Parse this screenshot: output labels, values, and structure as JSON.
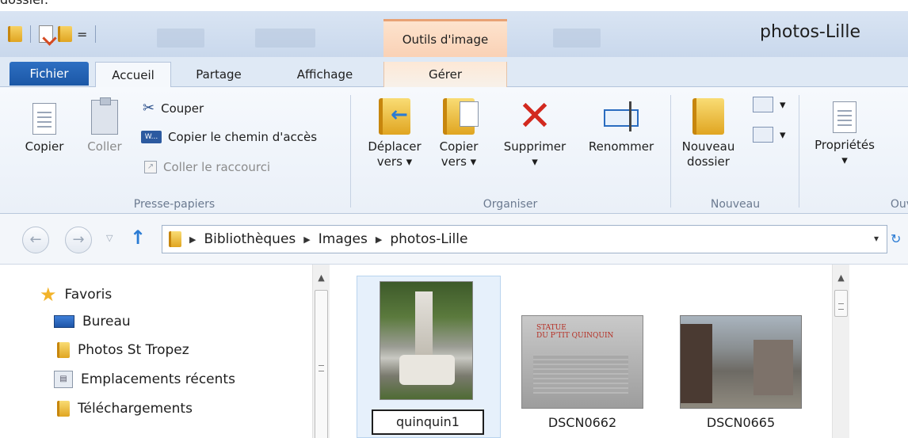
{
  "cropped_top_text": "dossier.",
  "window": {
    "title": "photos-Lille",
    "contextual_group": "Outils d'image"
  },
  "tabs": {
    "file": "Fichier",
    "home": "Accueil",
    "share": "Partage",
    "view": "Affichage",
    "manage": "Gérer"
  },
  "ribbon": {
    "clipboard": {
      "label": "Presse-papiers",
      "copy": "Copier",
      "paste": "Coller",
      "cut": "Couper",
      "copy_path": "Copier le chemin d'accès",
      "paste_shortcut": "Coller le raccourci"
    },
    "organize": {
      "label": "Organiser",
      "move_to": [
        "Déplacer",
        "vers ▾"
      ],
      "copy_to": [
        "Copier",
        "vers ▾"
      ],
      "delete": [
        "Supprimer",
        "▾"
      ],
      "rename": "Renommer"
    },
    "new": {
      "label": "Nouveau",
      "new_folder": [
        "Nouveau",
        "dossier"
      ]
    },
    "open": {
      "label": "Ouv",
      "properties": [
        "Propriétés",
        "▾"
      ]
    }
  },
  "address": {
    "crumbs": [
      "Bibliothèques",
      "Images",
      "photos-Lille"
    ]
  },
  "navpane": {
    "favorites": "Favoris",
    "items": [
      "Bureau",
      "Photos St Tropez",
      "Emplacements récents",
      "Téléchargements"
    ]
  },
  "files": [
    {
      "name": "quinquin1",
      "selected": true,
      "renaming": true
    },
    {
      "name": "DSCN0662",
      "selected": false,
      "plaque_text": [
        "STATUE",
        "DU P'TIT QUINQUIN"
      ]
    },
    {
      "name": "DSCN0665",
      "selected": false
    }
  ],
  "icons": {
    "x_mark": "✕",
    "refresh": "↻",
    "dropdown": "▾",
    "breadcrumb_sep": "▶"
  }
}
